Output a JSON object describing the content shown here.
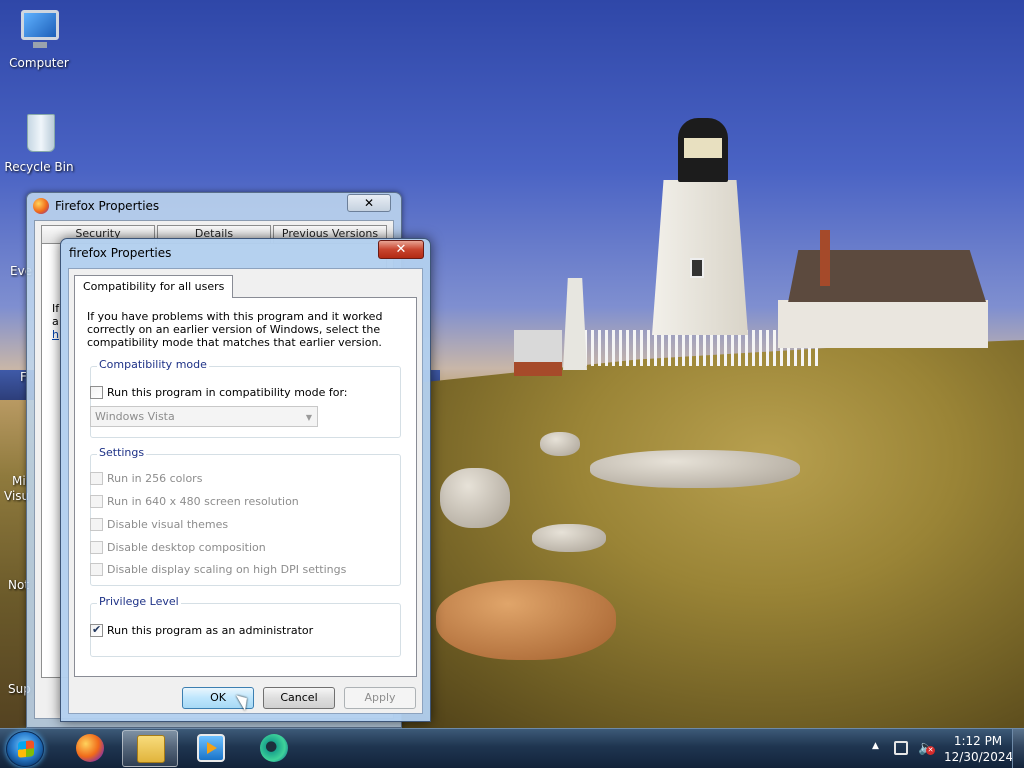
{
  "desktop": {
    "icons": [
      {
        "label": "Computer"
      },
      {
        "label": "Recycle Bin"
      }
    ],
    "edge_labels": [
      "Eve",
      "F",
      "Mi",
      "Visu",
      "Not",
      "Sup"
    ]
  },
  "background_window": {
    "title": "Firefox Properties",
    "close_glyph": "✕",
    "tabs": [
      "Security",
      "Details",
      "Previous Versions"
    ],
    "pane_lines": [
      "If",
      "a",
      "h"
    ]
  },
  "dialog": {
    "title": "firefox Properties",
    "close_glyph": "✕",
    "tab": "Compatibility for all users",
    "intro": "If you have problems with this program and it worked correctly on an earlier version of Windows, select the compatibility mode that matches that earlier version.",
    "compat_group": "Compatibility mode",
    "compat_checkbox": "Run this program in compatibility mode for:",
    "compat_select_value": "Windows Vista",
    "settings_group": "Settings",
    "settings": [
      "Run in 256 colors",
      "Run in 640 x 480 screen resolution",
      "Disable visual themes",
      "Disable desktop composition",
      "Disable display scaling on high DPI settings"
    ],
    "privilege_group": "Privilege Level",
    "admin_checkbox": "Run this program as an administrator",
    "admin_checked": true,
    "ok_label": "OK",
    "cancel_label": "Cancel",
    "apply_label": "Apply"
  },
  "taskbar": {
    "items": [
      {
        "icon": "firefox-icon"
      },
      {
        "icon": "file-explorer-icon",
        "active": true
      },
      {
        "icon": "media-player-icon"
      },
      {
        "icon": "edge-icon"
      }
    ],
    "time": "1:12 PM",
    "date": "12/30/2024"
  },
  "colors": {
    "accent": "#3c7fb1",
    "close_red": "#c8452f"
  }
}
